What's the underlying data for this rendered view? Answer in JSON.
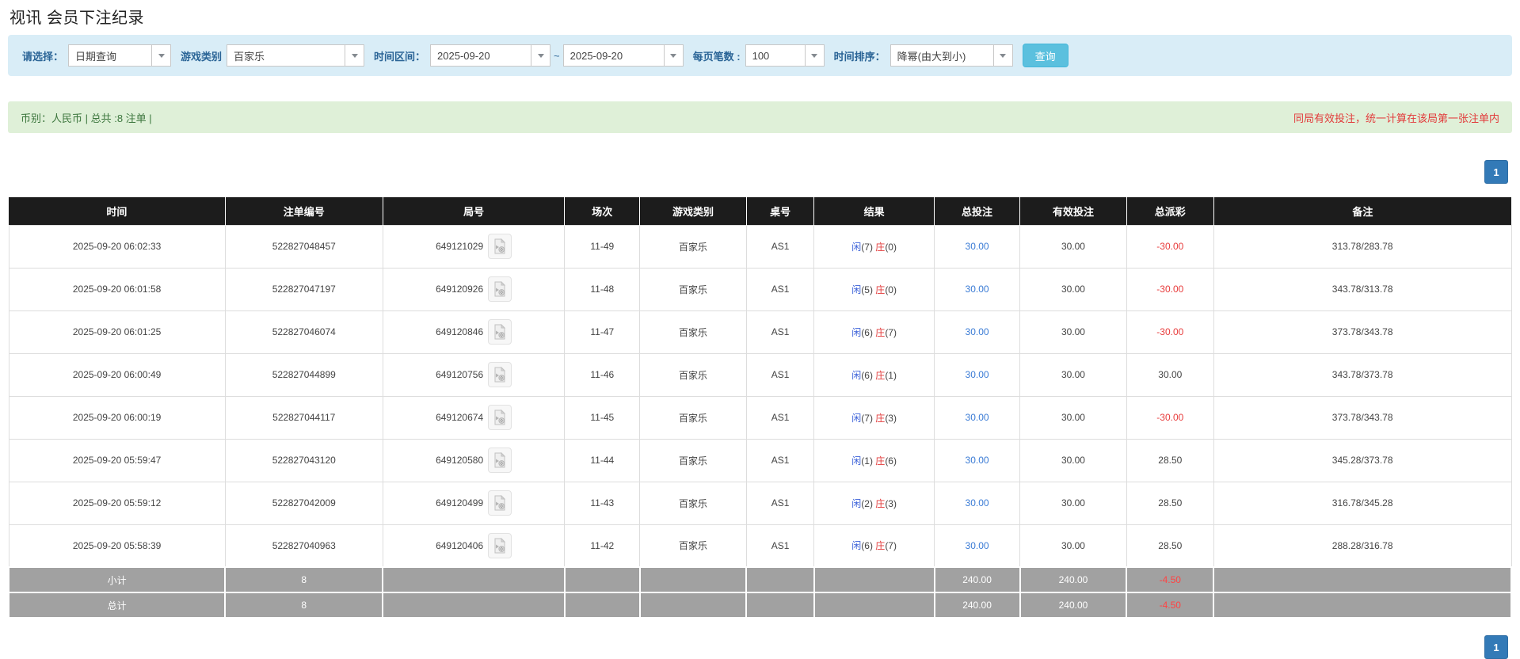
{
  "page": {
    "title": "视讯 会员下注纪录"
  },
  "colors": {
    "accent_blue": "#337ab7",
    "search_button_blue": "#5bc0de",
    "filter_panel_blue": "#d9edf7",
    "success_green_bg": "#dff0d8",
    "success_green_text": "#3c763d",
    "warning_red": "#e23b3b",
    "link_blue": "#3a7bd5",
    "player_blue": "#3a60d8",
    "banker_red": "#e23b3b",
    "header_black": "#1c1c1c",
    "summary_gray": "#a1a1a1"
  },
  "filters": {
    "select_label": "请选择：",
    "select_value": "日期查询",
    "game_type_label": "游戏类别",
    "game_type_value": "百家乐",
    "time_range_label": "时间区间：",
    "date_from": "2025-09-20",
    "tilde": "~",
    "date_to": "2025-09-20",
    "page_size_label": "每页笔数 :",
    "page_size_value": "100",
    "sort_label": "时间排序：",
    "sort_value": "降幂(由大到小)",
    "search_button": "查询"
  },
  "summary_bar": {
    "left_text": "币别：人民币 | 总共 :8 注单 |",
    "right_text": "同局有效投注，统一计算在该局第一张注单内"
  },
  "pagination": {
    "page": "1"
  },
  "table": {
    "headers": [
      "时间",
      "注单编号",
      "局号",
      "场次",
      "游戏类别",
      "桌号",
      "结果",
      "总投注",
      "有效投注",
      "总派彩",
      "备注"
    ],
    "col_widths_pct": [
      14.4,
      10.5,
      12.1,
      5.0,
      7.1,
      4.5,
      8.0,
      5.7,
      7.1,
      5.8,
      19.8
    ],
    "rows": [
      {
        "time": "2025-09-20 06:02:33",
        "bet_id": "522827048457",
        "round_id": "649121029",
        "session": "11-49",
        "game": "百家乐",
        "table_no": "AS1",
        "player_label": "闲",
        "player_score": "(7)",
        "banker_label": "庄",
        "banker_score": "(0)",
        "total_bet": "30.00",
        "valid_bet": "30.00",
        "payout": "-30.00",
        "payout_negative": true,
        "remark": "313.78/283.78"
      },
      {
        "time": "2025-09-20 06:01:58",
        "bet_id": "522827047197",
        "round_id": "649120926",
        "session": "11-48",
        "game": "百家乐",
        "table_no": "AS1",
        "player_label": "闲",
        "player_score": "(5)",
        "banker_label": "庄",
        "banker_score": "(0)",
        "total_bet": "30.00",
        "valid_bet": "30.00",
        "payout": "-30.00",
        "payout_negative": true,
        "remark": "343.78/313.78"
      },
      {
        "time": "2025-09-20 06:01:25",
        "bet_id": "522827046074",
        "round_id": "649120846",
        "session": "11-47",
        "game": "百家乐",
        "table_no": "AS1",
        "player_label": "闲",
        "player_score": "(6)",
        "banker_label": "庄",
        "banker_score": "(7)",
        "total_bet": "30.00",
        "valid_bet": "30.00",
        "payout": "-30.00",
        "payout_negative": true,
        "remark": "373.78/343.78"
      },
      {
        "time": "2025-09-20 06:00:49",
        "bet_id": "522827044899",
        "round_id": "649120756",
        "session": "11-46",
        "game": "百家乐",
        "table_no": "AS1",
        "player_label": "闲",
        "player_score": "(6)",
        "banker_label": "庄",
        "banker_score": "(1)",
        "total_bet": "30.00",
        "valid_bet": "30.00",
        "payout": "30.00",
        "payout_negative": false,
        "remark": "343.78/373.78"
      },
      {
        "time": "2025-09-20 06:00:19",
        "bet_id": "522827044117",
        "round_id": "649120674",
        "session": "11-45",
        "game": "百家乐",
        "table_no": "AS1",
        "player_label": "闲",
        "player_score": "(7)",
        "banker_label": "庄",
        "banker_score": "(3)",
        "total_bet": "30.00",
        "valid_bet": "30.00",
        "payout": "-30.00",
        "payout_negative": true,
        "remark": "373.78/343.78"
      },
      {
        "time": "2025-09-20 05:59:47",
        "bet_id": "522827043120",
        "round_id": "649120580",
        "session": "11-44",
        "game": "百家乐",
        "table_no": "AS1",
        "player_label": "闲",
        "player_score": "(1)",
        "banker_label": "庄",
        "banker_score": "(6)",
        "total_bet": "30.00",
        "valid_bet": "30.00",
        "payout": "28.50",
        "payout_negative": false,
        "remark": "345.28/373.78"
      },
      {
        "time": "2025-09-20 05:59:12",
        "bet_id": "522827042009",
        "round_id": "649120499",
        "session": "11-43",
        "game": "百家乐",
        "table_no": "AS1",
        "player_label": "闲",
        "player_score": "(2)",
        "banker_label": "庄",
        "banker_score": "(3)",
        "total_bet": "30.00",
        "valid_bet": "30.00",
        "payout": "28.50",
        "payout_negative": false,
        "remark": "316.78/345.28"
      },
      {
        "time": "2025-09-20 05:58:39",
        "bet_id": "522827040963",
        "round_id": "649120406",
        "session": "11-42",
        "game": "百家乐",
        "table_no": "AS1",
        "player_label": "闲",
        "player_score": "(6)",
        "banker_label": "庄",
        "banker_score": "(7)",
        "total_bet": "30.00",
        "valid_bet": "30.00",
        "payout": "28.50",
        "payout_negative": false,
        "remark": "288.28/316.78"
      }
    ],
    "subtotal": {
      "label": "小计",
      "count": "8",
      "total_bet": "240.00",
      "valid_bet": "240.00",
      "payout": "-4.50",
      "payout_negative": true
    },
    "total": {
      "label": "总计",
      "count": "8",
      "total_bet": "240.00",
      "valid_bet": "240.00",
      "payout": "-4.50",
      "payout_negative": true
    }
  },
  "icons": {
    "dropdown_arrow": "chevron-down-icon",
    "video_replay": "video-replay-icon"
  }
}
